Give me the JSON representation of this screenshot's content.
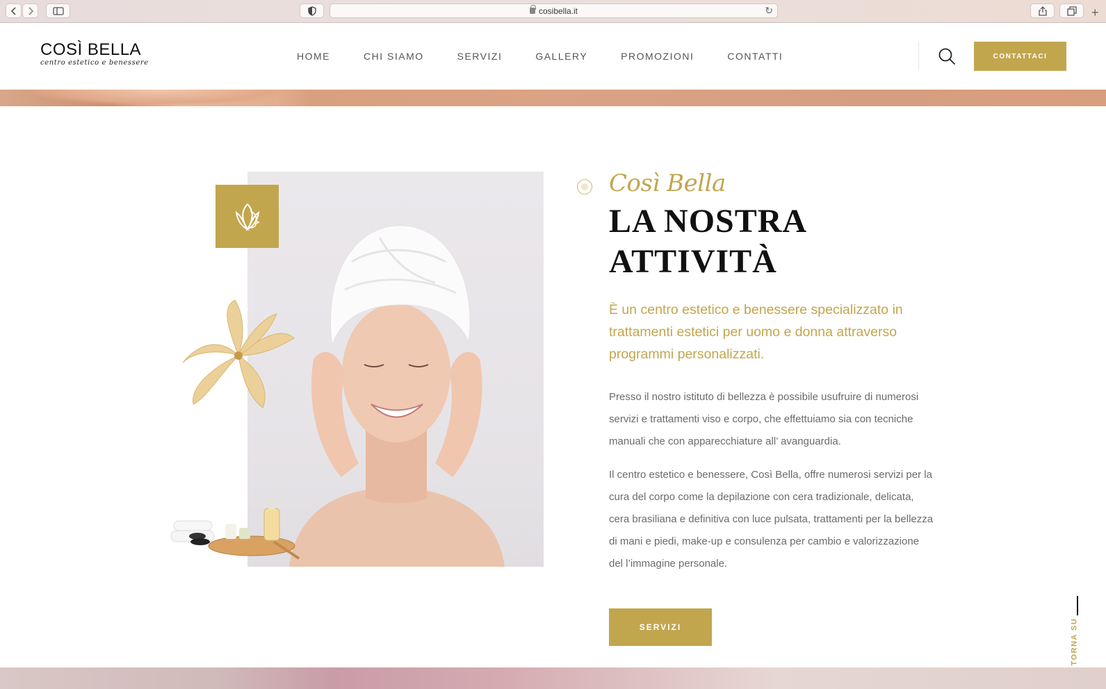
{
  "browser": {
    "url": "cosibella.it"
  },
  "header": {
    "logo_title": "COSÌ BELLA",
    "logo_subtitle": "centro estetico e benessere",
    "nav": [
      "HOME",
      "CHI SIAMO",
      "SERVIZI",
      "GALLERY",
      "PROMOZIONI",
      "CONTATTI"
    ],
    "cta_label": "CONTATTACI"
  },
  "about": {
    "script_title": "Così Bella",
    "title_line1": "LA NOSTRA",
    "title_line2": "ATTIVITÀ",
    "lead": "È un centro estetico e benessere specializzato in trattamenti estetici per uomo e donna attraverso programmi personalizzati.",
    "paragraph1": "Presso il nostro istituto di bellezza è possibile usufruire di numerosi servizi e trattamenti viso e corpo, che effettuiamo sia con tecniche manuali che con apparecchiature all’ avanguardia.",
    "paragraph2": "Il centro estetico e benessere, Così Bella, offre numerosi servizi per la cura del corpo come la depilazione con cera tradizionale, delicata, cera brasiliana e definitiva con luce pulsata, trattamenti per la bellezza di mani e piedi, make-up e consulenza per cambio e valorizzazione del l’immagine personale.",
    "button_label": "SERVIZI"
  },
  "back_to_top": "TORNA SU",
  "colors": {
    "accent": "#c2a64e",
    "text": "#6b6b6b",
    "heading": "#111111"
  }
}
